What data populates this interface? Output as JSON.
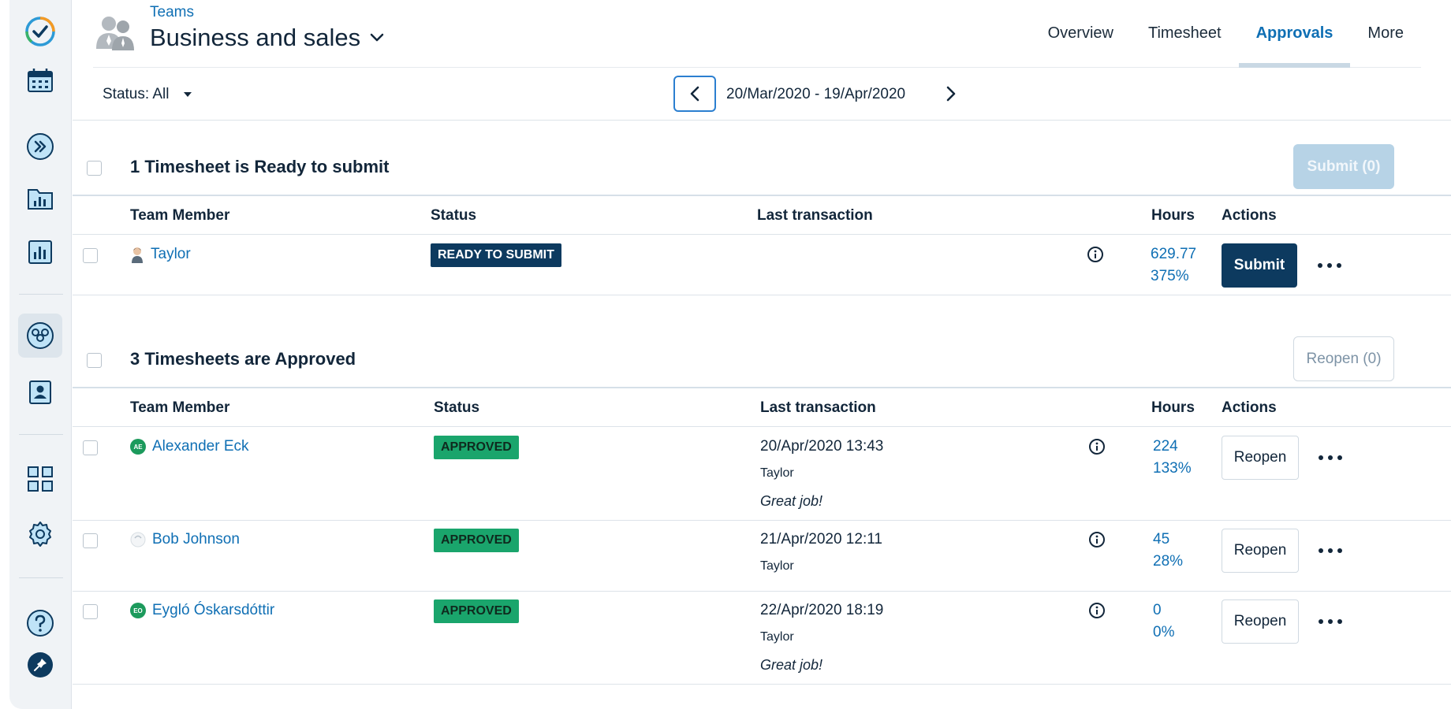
{
  "header": {
    "breadcrumb": "Teams",
    "team_name": "Business and sales",
    "tabs": [
      {
        "label": "Overview",
        "active": false
      },
      {
        "label": "Timesheet",
        "active": false
      },
      {
        "label": "Approvals",
        "active": true
      },
      {
        "label": "More",
        "active": false
      }
    ]
  },
  "toolbar": {
    "status_filter": "Status: All",
    "date_range": "20/Mar/2020 - 19/Apr/2020"
  },
  "columns": {
    "member": "Team Member",
    "status": "Status",
    "last_transaction": "Last transaction",
    "hours": "Hours",
    "actions": "Actions"
  },
  "ready_section": {
    "title": "1 Timesheet is Ready to submit",
    "bulk_button": "Submit (0)",
    "rows": [
      {
        "name": "Taylor",
        "status": "READY TO SUBMIT",
        "hours": "629.77",
        "percent": "375%",
        "action": "Submit"
      }
    ]
  },
  "approved_section": {
    "title": "3 Timesheets are Approved",
    "bulk_button": "Reopen (0)",
    "rows": [
      {
        "initials": "AE",
        "name": "Alexander Eck",
        "status": "APPROVED",
        "time": "20/Apr/2020 13:43",
        "by": "Taylor",
        "note": "Great job!",
        "hours": "224",
        "percent": "133%",
        "action": "Reopen"
      },
      {
        "initials": "",
        "name": "Bob Johnson",
        "status": "APPROVED",
        "time": "21/Apr/2020 12:11",
        "by": "Taylor",
        "note": "",
        "hours": "45",
        "percent": "28%",
        "action": "Reopen"
      },
      {
        "initials": "EO",
        "name": "Eygló Óskarsdóttir",
        "status": "APPROVED",
        "time": "22/Apr/2020 18:19",
        "by": "Taylor",
        "note": "Great job!",
        "hours": "0",
        "percent": "0%",
        "action": "Reopen"
      }
    ]
  },
  "colors": {
    "accent": "#0f6fb4",
    "navy": "#0d3a5f",
    "approved": "#1aa56c"
  },
  "icons": {
    "sidebar": [
      "app-logo-icon",
      "calendar-icon",
      "forward-icon",
      "projects-folder-icon",
      "reports-chart-icon",
      "teams-icon",
      "contact-icon",
      "apps-grid-icon",
      "settings-gear-icon",
      "help-icon",
      "pin-icon"
    ]
  }
}
